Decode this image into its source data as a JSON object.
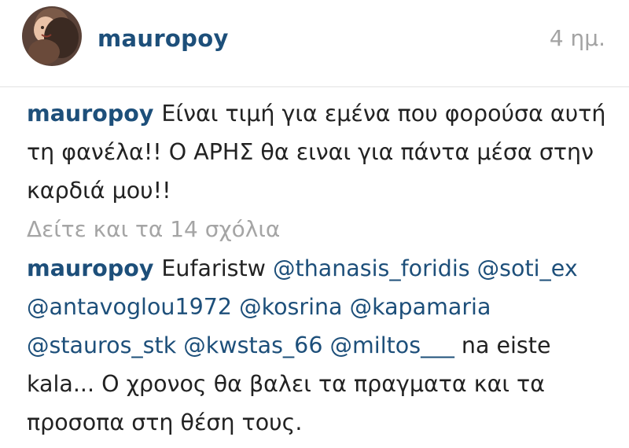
{
  "post": {
    "username": "mauropoy",
    "timestamp": "4 ημ."
  },
  "comments": [
    {
      "username": "mauropoy",
      "text": "Είναι τιμή για εμένα που φορούσα αυτή τη φανέλα!! Ο ΑΡΗΣ θα ειναι για πάντα μέσα στην καρδιά μου!!"
    },
    {
      "username": "mauropoy",
      "text_start": "Eufaristw ",
      "mentions": [
        "@thanasis_foridis",
        "@soti_ex",
        "@antavoglou1972",
        "@kosrina",
        "@kapamaria",
        "@stauros_stk",
        "@kwstas_66",
        "@miltos___"
      ],
      "text_end": "  na eiste kala... Ο χρονος θα βαλει τα πραγματα και τα προσοπα στη θέση τους."
    }
  ],
  "view_all_comments": "Δείτε και τα 14 σχόλια",
  "colors": {
    "username": "#1d4f7a",
    "muted": "#a5a5a5",
    "text": "#222222"
  }
}
